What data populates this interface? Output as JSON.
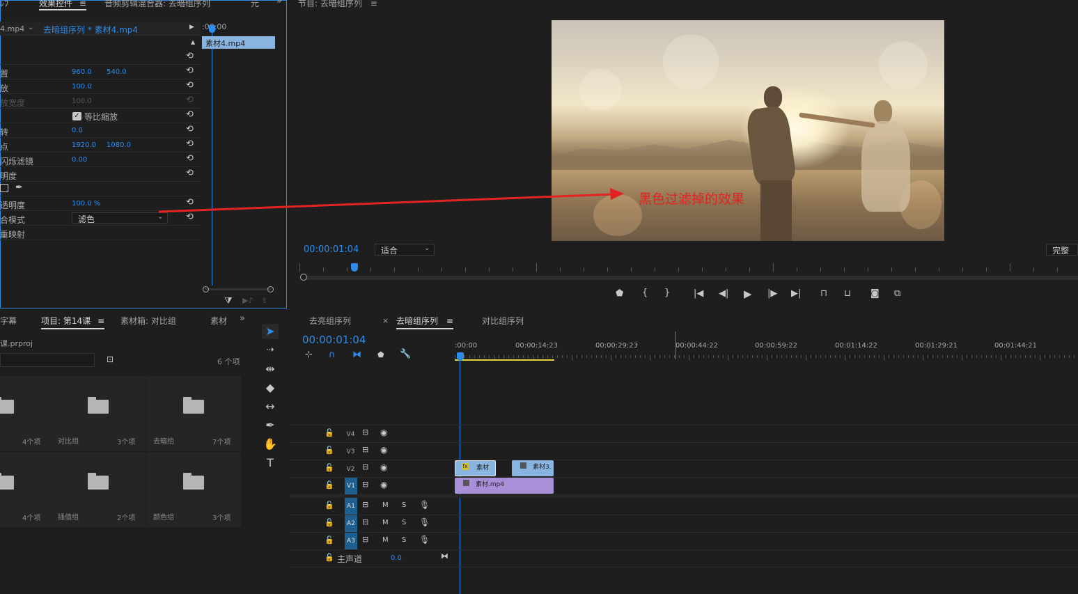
{
  "effects_panel": {
    "tabs": [
      "效果控件",
      "音频剪辑混合器: 去暗组序列",
      "元"
    ],
    "menu_icon": "≡",
    "more_icon": "»",
    "source_clip": "4.mp4",
    "sequence_path": "去暗组序列 * 素材4.mp4",
    "mini_timecode": ":00:00",
    "mini_clip_label": "素材4.mp4",
    "rows": [
      {
        "label": "",
        "v1": "",
        "v2": ""
      },
      {
        "label": "置",
        "v1": "960.0",
        "v2": "540.0"
      },
      {
        "label": "放",
        "v1": "100.0",
        "v2": ""
      },
      {
        "label": "放宽度",
        "v1": "100.0",
        "v2": ""
      },
      {
        "label": "",
        "v1": "",
        "v2": ""
      },
      {
        "label": "转",
        "v1": "0.0",
        "v2": ""
      },
      {
        "label": "点",
        "v1": "1920.0",
        "v2": "1080.0"
      },
      {
        "label": "闪烁滤镜",
        "v1": "0.00",
        "v2": ""
      },
      {
        "label": "明度",
        "v1": "",
        "v2": ""
      },
      {
        "label": "",
        "v1": "",
        "v2": ""
      },
      {
        "label": "透明度",
        "v1": "100.0 %",
        "v2": ""
      },
      {
        "label": "合模式",
        "v1": "",
        "v2": ""
      },
      {
        "label": "重映射",
        "v1": "",
        "v2": ""
      }
    ],
    "uniform_scale": "等比缩放",
    "blend_mode_value": "滤色"
  },
  "program_monitor": {
    "title": "节目: 去暗组序列",
    "menu_icon": "≡",
    "annotation_text": "黑色过滤掉的效果",
    "timecode": "00:00:01:04",
    "fit": "适合",
    "quality": "完整",
    "controls": [
      "marker-icon",
      "in-point-icon",
      "out-point-icon",
      "go-to-in-icon",
      "step-back-icon",
      "play-icon",
      "step-forward-icon",
      "go-to-out-icon",
      "lift-icon",
      "extract-icon",
      "camera-icon",
      "compare-icon"
    ]
  },
  "project_panel": {
    "tabs": [
      "字幕",
      "项目: 第14课",
      "素材箱: 对比组",
      "素材"
    ],
    "menu_icon": "≡",
    "more_icon": "»",
    "project_file": "课.prproj",
    "item_count": "6 个项",
    "bins": [
      {
        "name": "",
        "count": "4个项"
      },
      {
        "name": "对比组",
        "count": "3个项"
      },
      {
        "name": "去暗组",
        "count": "7个项"
      },
      {
        "name": "",
        "count": "4个项"
      },
      {
        "name": "插值组",
        "count": "2个项"
      },
      {
        "name": "颜色组",
        "count": "3个项"
      }
    ]
  },
  "timeline": {
    "tabs": [
      "去亮组序列",
      "去暗组序列",
      "对比组序列"
    ],
    "close_icon": "×",
    "menu_icon": "≡",
    "timecode": "00:00:01:04",
    "ruler": [
      ":00:00",
      "00:00:14:23",
      "00:00:29:23",
      "00:00:44:22",
      "00:00:59:22",
      "00:01:14:22",
      "00:01:29:21",
      "00:01:44:21"
    ],
    "video_tracks": [
      "V4",
      "V3",
      "V2",
      "V1"
    ],
    "audio_tracks": [
      "A1",
      "A2",
      "A3"
    ],
    "master_label": "主声道",
    "master_value": "0.0",
    "mute": "M",
    "solo": "S",
    "clips": {
      "v2_a": "素材",
      "v2_b": "素材3.",
      "v1": "素材.mp4"
    },
    "fx_badge": "fx"
  },
  "colors": {
    "accent": "#2d8ceb",
    "clip_video": "#8ab4e0",
    "clip_purple": "#a98fd8",
    "annotation": "#e52222"
  }
}
